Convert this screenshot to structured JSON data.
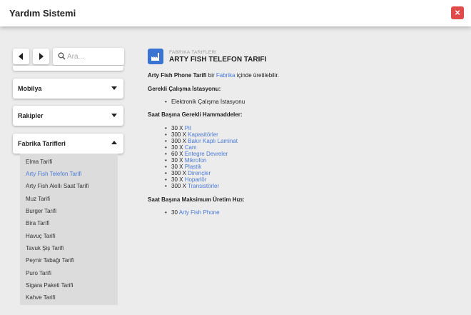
{
  "window": {
    "title": "Yardım Sistemi",
    "close_icon": "×"
  },
  "sidebar": {
    "search_placeholder": "Ara...",
    "categories": [
      {
        "label": "Mobilya",
        "expanded": false
      },
      {
        "label": "Rakipler",
        "expanded": false
      },
      {
        "label": "Fabrika Tarifleri",
        "expanded": true
      }
    ],
    "recipes": [
      {
        "label": "Elma Tarifi"
      },
      {
        "label": "Arty Fish Telefon Tarifi",
        "active": true
      },
      {
        "label": "Arty Fish Akıllı Saat Tarifi"
      },
      {
        "label": "Muz Tarifi"
      },
      {
        "label": "Burger Tarifi"
      },
      {
        "label": "Bira Tarifi"
      },
      {
        "label": "Havuç Tarifi"
      },
      {
        "label": "Tavuk Şiş Tarifi"
      },
      {
        "label": "Peynir Tabağı Tarifi"
      },
      {
        "label": "Puro Tarifi"
      },
      {
        "label": "Sigara Paketi Tarifi"
      },
      {
        "label": "Kahve Tarifi"
      }
    ]
  },
  "content": {
    "category": "FABRIKA TARIFLERI",
    "title": "ARTY FISH TELEFON TARIFI",
    "intro": {
      "product": "Arty Fish Phone Tarifi",
      "mid": " bir ",
      "link": "Fabrika",
      "end": " içinde üretilebilir."
    },
    "workstation_heading": "Gerekli Çalışma İstasyonu:",
    "workstation": "Elektronik Çalışma İstasyonu",
    "materials_heading": "Saat Başına Gerekli Hammaddeler:",
    "materials": [
      {
        "qty": "30 X",
        "name": "Pil"
      },
      {
        "qty": "300 X",
        "name": "Kapasitörler"
      },
      {
        "qty": "300 X",
        "name": "Bakır Kaplı Laminat"
      },
      {
        "qty": "30 X",
        "name": "Cam"
      },
      {
        "qty": "60 X",
        "name": "Entegre Devreler"
      },
      {
        "qty": "30 X",
        "name": "Mikrofon"
      },
      {
        "qty": "30 X",
        "name": "Plastik"
      },
      {
        "qty": "300 X",
        "name": "Dirençler"
      },
      {
        "qty": "30 X",
        "name": "Hoparlör"
      },
      {
        "qty": "300 X",
        "name": "Transistörler"
      }
    ],
    "output_heading": "Saat Başına Maksimum Üretim Hızı:",
    "output": {
      "qty": "30",
      "name": "Arty Fish Phone"
    }
  },
  "colors": {
    "accent": "#4a7ad6",
    "close": "#e04a4a",
    "icon_bg": "#3a73d2"
  }
}
